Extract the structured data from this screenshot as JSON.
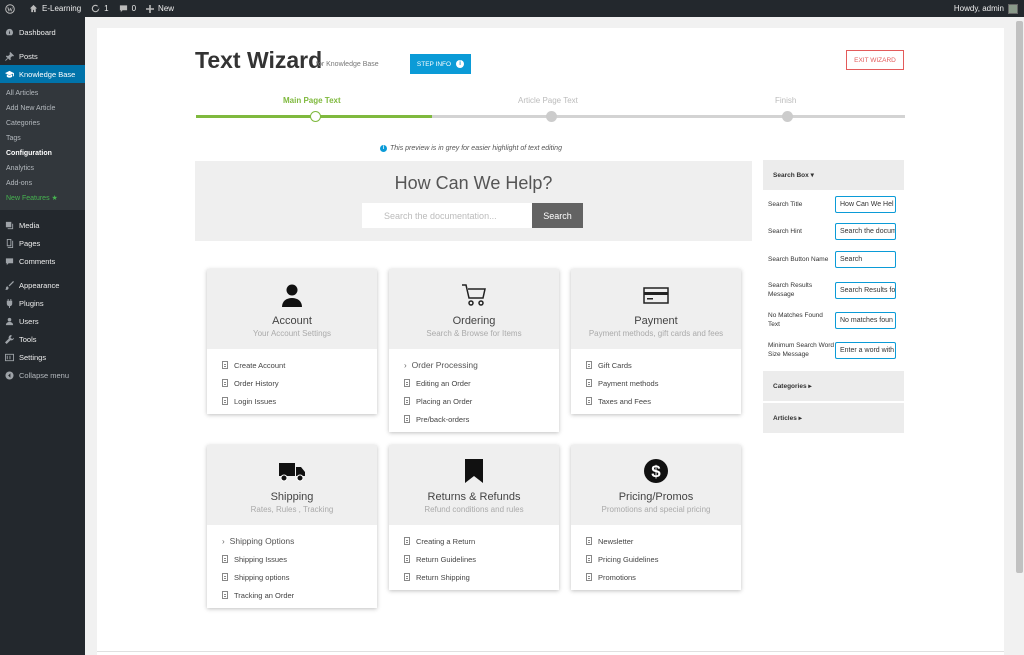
{
  "adminbar": {
    "site_name": "E-Learning",
    "updates_count": "1",
    "comments_count": "0",
    "new_label": "New",
    "howdy": "Howdy, admin"
  },
  "sidebar": {
    "top": [
      {
        "label": "Dashboard",
        "icon": "dashboard-icon"
      },
      {
        "label": "Posts",
        "icon": "pin-icon"
      }
    ],
    "kb": {
      "label": "Knowledge Base",
      "icon": "mortarboard-icon"
    },
    "sub_items": [
      "All Articles",
      "Add New Article",
      "Categories",
      "Tags",
      "Configuration",
      "Analytics",
      "Add-ons",
      "New Features ★"
    ],
    "middle": [
      {
        "label": "Media",
        "icon": "media-icon"
      },
      {
        "label": "Pages",
        "icon": "pages-icon"
      },
      {
        "label": "Comments",
        "icon": "comment-icon"
      }
    ],
    "bottom": [
      {
        "label": "Appearance",
        "icon": "brush-icon"
      },
      {
        "label": "Plugins",
        "icon": "plug-icon"
      },
      {
        "label": "Users",
        "icon": "users-icon"
      },
      {
        "label": "Tools",
        "icon": "wrench-icon"
      },
      {
        "label": "Settings",
        "icon": "settings-icon"
      },
      {
        "label": "Collapse menu",
        "icon": "collapse-icon"
      }
    ]
  },
  "wizard": {
    "title": "Text Wizard",
    "subtitle": "for Knowledge Base",
    "step_info_label": "STEP INFO",
    "exit_label": "EXIT WIZARD",
    "steps": [
      "Main Page Text",
      "Article Page Text",
      "Finish"
    ],
    "progress": 0.333,
    "preview_note": "This preview is in grey for easier highlight of text editing"
  },
  "hero": {
    "title": "How Can We Help?",
    "search_placeholder": "Search the documentation...",
    "search_button": "Search"
  },
  "categories": [
    {
      "title": "Account",
      "subtitle": "Your Account Settings",
      "icon": "user-icon",
      "sub_category": "",
      "articles": [
        "Create Account",
        "Order History",
        "Login Issues"
      ]
    },
    {
      "title": "Ordering",
      "subtitle": "Search & Browse for Items",
      "icon": "cart-icon",
      "sub_category": "Order Processing",
      "articles": [
        "Editing an Order",
        "Placing an Order",
        "Pre/back-orders"
      ]
    },
    {
      "title": "Payment",
      "subtitle": "Payment methods, gift cards and fees",
      "icon": "credit-card-icon",
      "sub_category": "",
      "articles": [
        "Gift Cards",
        "Payment methods",
        "Taxes and Fees"
      ]
    },
    {
      "title": "Shipping",
      "subtitle": "Rates, Rules , Tracking",
      "icon": "truck-icon",
      "sub_category": "Shipping Options",
      "articles": [
        "Shipping Issues",
        "Shipping options",
        "Tracking an Order"
      ]
    },
    {
      "title": "Returns & Refunds",
      "subtitle": "Refund conditions and rules",
      "icon": "bookmark-icon",
      "sub_category": "",
      "articles": [
        "Creating a Return",
        "Return Guidelines",
        "Return Shipping"
      ]
    },
    {
      "title": "Pricing/Promos",
      "subtitle": "Promotions and special pricing",
      "icon": "dollar-icon",
      "sub_category": "",
      "articles": [
        "Newsletter",
        "Pricing Guidelines",
        "Promotions"
      ]
    }
  ],
  "settings_panel": {
    "search_box_label": "Search Box ▾",
    "fields": [
      {
        "label": "Search Title",
        "value": "How Can We Hel"
      },
      {
        "label": "Search Hint",
        "value": "Search the docum"
      },
      {
        "label": "Search Button Name",
        "value": "Search"
      },
      {
        "label": "Search Results Message",
        "value": "Search Results fo"
      },
      {
        "label": "No Matches Found Text",
        "value": "No matches foun"
      },
      {
        "label": "Minimum Search Word Size Message",
        "value": "Enter a word with"
      }
    ],
    "categories_label": "Categories ▸",
    "articles_label": "Articles ▸"
  },
  "colors": {
    "accent": "#0b9bd7",
    "progress": "#7fb93e",
    "exit": "#e35b5b",
    "wp_blue": "#0073aa"
  }
}
